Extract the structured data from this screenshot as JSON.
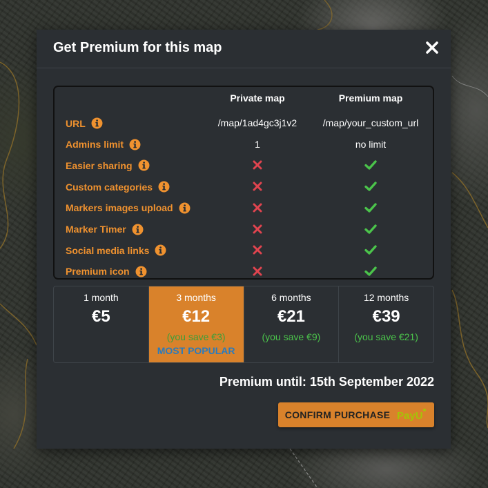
{
  "modal": {
    "title": "Get Premium for this map"
  },
  "features": {
    "columns": {
      "private": "Private map",
      "premium": "Premium map"
    },
    "rows": [
      {
        "label": "URL",
        "private": "/map/1ad4gc3j1v2",
        "premium": "/map/your_custom_url"
      },
      {
        "label": "Admins limit",
        "private": "1",
        "premium": "no limit"
      },
      {
        "label": "Easier sharing",
        "private": false,
        "premium": true
      },
      {
        "label": "Custom categories",
        "private": false,
        "premium": true
      },
      {
        "label": "Markers images upload",
        "private": false,
        "premium": true
      },
      {
        "label": "Marker Timer",
        "private": false,
        "premium": true
      },
      {
        "label": "Social media links",
        "private": false,
        "premium": true
      },
      {
        "label": "Premium icon",
        "private": false,
        "premium": true
      }
    ]
  },
  "plans": [
    {
      "duration": "1 month",
      "price": "€5",
      "save": "",
      "popular": "",
      "selected": false
    },
    {
      "duration": "3 months",
      "price": "€12",
      "save": "(you save €3)",
      "popular": "MOST POPULAR",
      "selected": true
    },
    {
      "duration": "6 months",
      "price": "€21",
      "save": "(you save €9)",
      "popular": "",
      "selected": false
    },
    {
      "duration": "12 months",
      "price": "€39",
      "save": "(you save €21)",
      "popular": "",
      "selected": false
    }
  ],
  "premium_until": "Premium until: 15th September 2022",
  "confirm": {
    "label": "CONFIRM PURCHASE",
    "logo": "PayU"
  },
  "colors": {
    "accent": "#d9822b",
    "feature_label": "#f0922f",
    "check": "#4bc44b",
    "cross": "#e0444f",
    "popular": "#2a7bbd",
    "modal_bg": "#2b2f33"
  },
  "icons": {
    "close": "close-icon",
    "info": "info-icon",
    "check": "check-icon",
    "cross": "cross-icon"
  }
}
